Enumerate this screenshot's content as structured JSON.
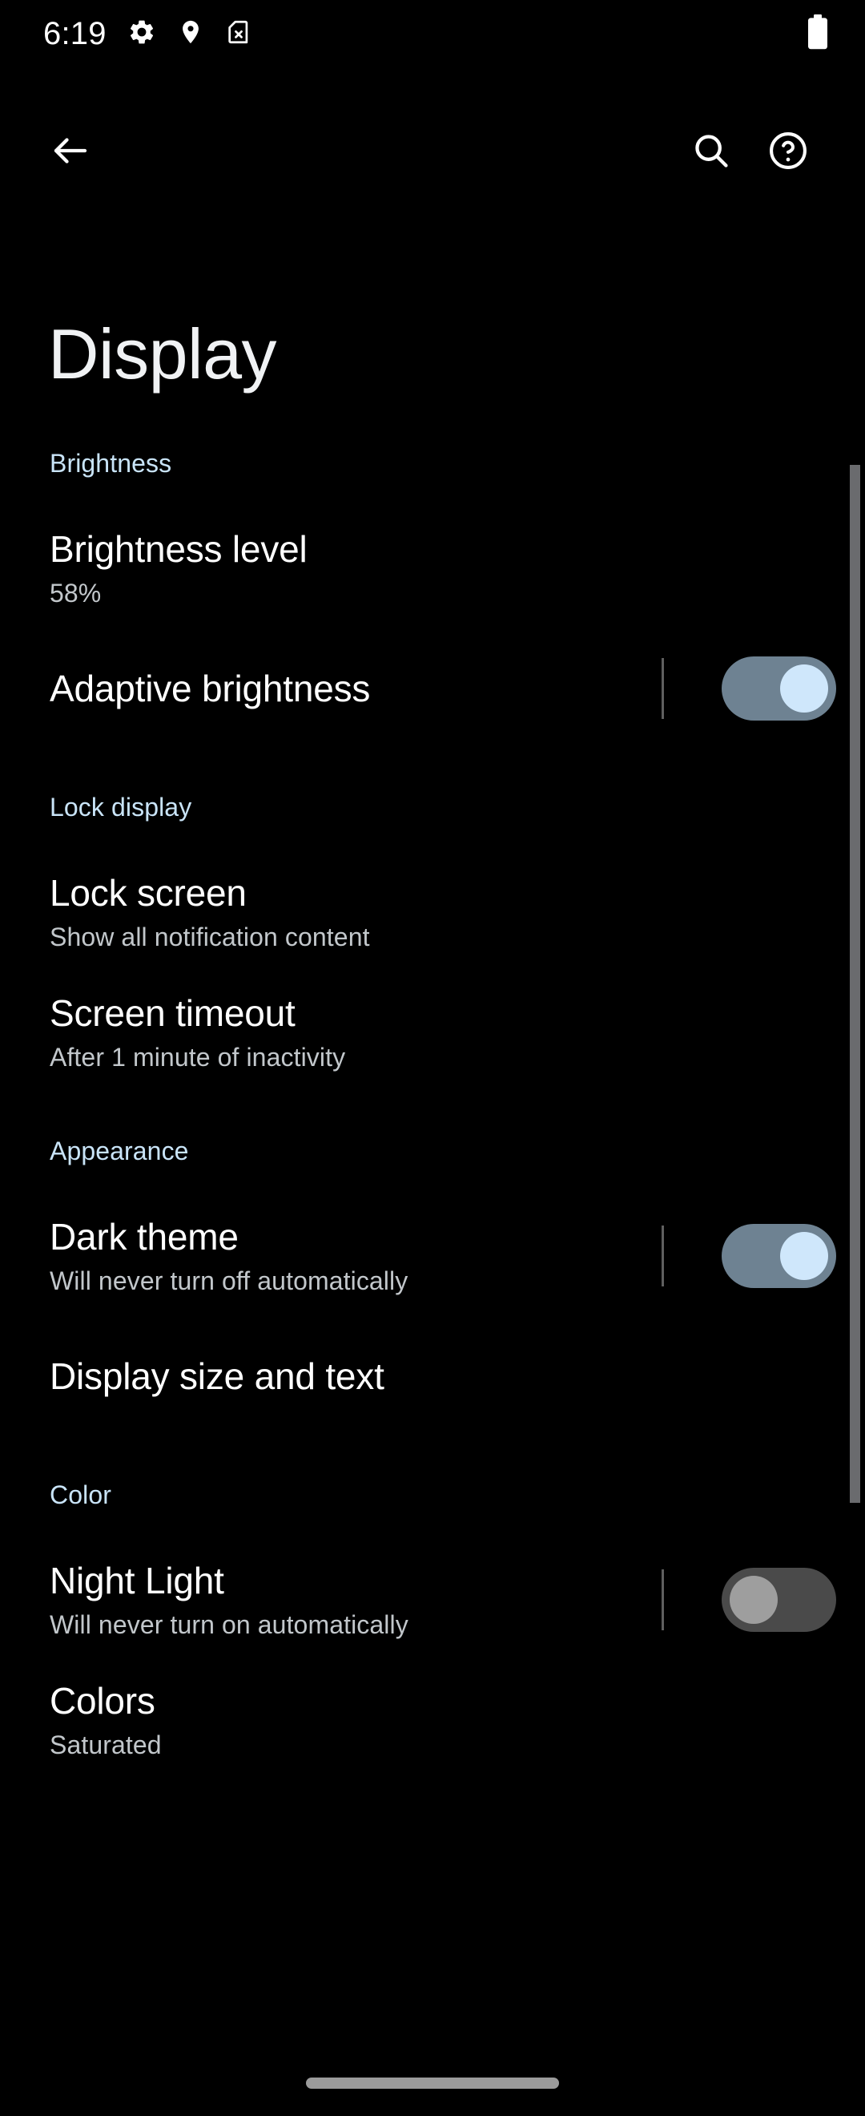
{
  "status_bar": {
    "time": "6:19",
    "icons": [
      "gear-icon",
      "location-pin-icon",
      "sim-card-off-icon"
    ],
    "battery": "battery-full-icon"
  },
  "app_bar": {
    "back": "back-arrow-icon",
    "search": "search-icon",
    "help": "help-circle-icon"
  },
  "page": {
    "title": "Display"
  },
  "sections": [
    {
      "header": "Brightness",
      "items": [
        {
          "title": "Brightness level",
          "summary": "58%",
          "toggle": null
        },
        {
          "title": "Adaptive brightness",
          "summary": "",
          "toggle": "on"
        }
      ]
    },
    {
      "header": "Lock display",
      "items": [
        {
          "title": "Lock screen",
          "summary": "Show all notification content",
          "toggle": null
        },
        {
          "title": "Screen timeout",
          "summary": "After 1 minute of inactivity",
          "toggle": null
        }
      ]
    },
    {
      "header": "Appearance",
      "items": [
        {
          "title": "Dark theme",
          "summary": "Will never turn off automatically",
          "toggle": "on"
        },
        {
          "title": "Display size and text",
          "summary": "",
          "toggle": null
        }
      ]
    },
    {
      "header": "Color",
      "items": [
        {
          "title": "Night Light",
          "summary": "Will never turn on automatically",
          "toggle": "off"
        },
        {
          "title": "Colors",
          "summary": "Saturated",
          "toggle": null
        }
      ]
    }
  ],
  "colors": {
    "background": "#000000",
    "section_header": "#c9e4f8",
    "title_text": "#ffffff",
    "summary_text": "#c2c7cb",
    "switch_on_track": "#6e8292",
    "switch_on_thumb": "#cfe7fb",
    "switch_off_track": "#4a4a4a",
    "switch_off_thumb": "#9e9e9e",
    "scrollbar": "#6a6b6e",
    "nav_pill": "#9b9b9b"
  }
}
